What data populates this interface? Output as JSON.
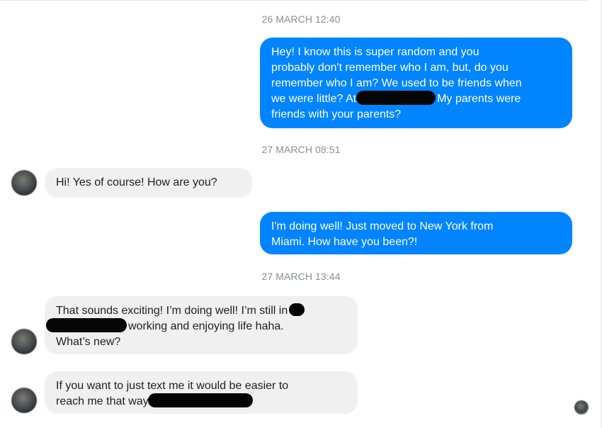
{
  "conversation": {
    "stamp_1": "26 MARCH 12:40",
    "stamp_2": "27 MARCH 08:51",
    "stamp_3": "27 MARCH 13:44",
    "msg_1": {
      "line1": "Hey! I know this is super random and you",
      "line2": "probably don't remember who I am, but, do you",
      "line3": "remember who I am? We used to be friends when",
      "line4_before": "we were little? At",
      "line4_after": "My parents were",
      "line5": "friends with your parents?"
    },
    "msg_2": {
      "text": "Hi! Yes of course! How are you?"
    },
    "msg_3": {
      "line1": "I'm doing well! Just moved to New York from",
      "line2": "Miami. How have you been?!"
    },
    "msg_4": {
      "line1": "That sounds exciting! I’m doing well! I’m still in",
      "line2": "working and enjoying life haha.",
      "line3": "What’s new?"
    },
    "msg_5": {
      "line1": "If you want to just text me it would be easier to",
      "line2": "reach me that way."
    }
  },
  "colors": {
    "outgoing_bubble": "#0084ff",
    "incoming_bubble": "#f1f0f0",
    "timestamp_text": "#8a8d91",
    "redaction": "#050505"
  }
}
